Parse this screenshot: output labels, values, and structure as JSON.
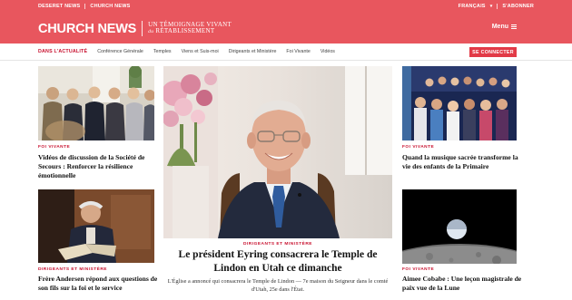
{
  "topbar": {
    "links": [
      "DESERET NEWS",
      "CHURCH NEWS"
    ],
    "language": "FRANÇAIS",
    "subscribe": "S'ABONNER"
  },
  "header": {
    "logo": "CHURCH NEWS",
    "tagline_line1": "UN TÉMOIGNAGE VIVANT",
    "tagline_small": "du",
    "tagline_line2": "RÉTABLISSEMENT",
    "menu_label": "Menu"
  },
  "subnav": {
    "items": [
      "DANS L'ACTUALITÉ",
      "Conférence Générale",
      "Temples",
      "Viens et Suis-moi",
      "Dirigeants et Ministère",
      "Foi Vivante",
      "Vidéos"
    ],
    "connect": "SE CONNECTER"
  },
  "articles": {
    "left_top": {
      "kicker": "FOI VIVANTE",
      "title": "Vidéos de discussion de la Société de Secours : Renforcer la résilience émotionnelle"
    },
    "left_bottom": {
      "kicker": "DIRIGEANTS ET MINISTÈRE",
      "title": "Frère Andersen répond aux questions de son fils sur la foi et le service"
    },
    "hero": {
      "kicker": "DIRIGEANTS ET MINISTÈRE",
      "title": "Le président Eyring consacrera le Temple de Lindon en Utah ce dimanche",
      "summary": "L'Église a annoncé qui consacrera le Temple de Lindon — 7e maison du Seigneur dans le comté d'Utah, 25e dans l'État."
    },
    "right_top": {
      "kicker": "FOI VIVANTE",
      "title": "Quand la musique sacrée transforme la vie des enfants de la Primaire"
    },
    "right_bottom": {
      "kicker": "FOI VIVANTE",
      "title": "Aimee Cobabe : Une leçon magistrale de paix vue de la Lune"
    }
  },
  "colors": {
    "brand": "#e8565e",
    "accent": "#c8102e"
  }
}
